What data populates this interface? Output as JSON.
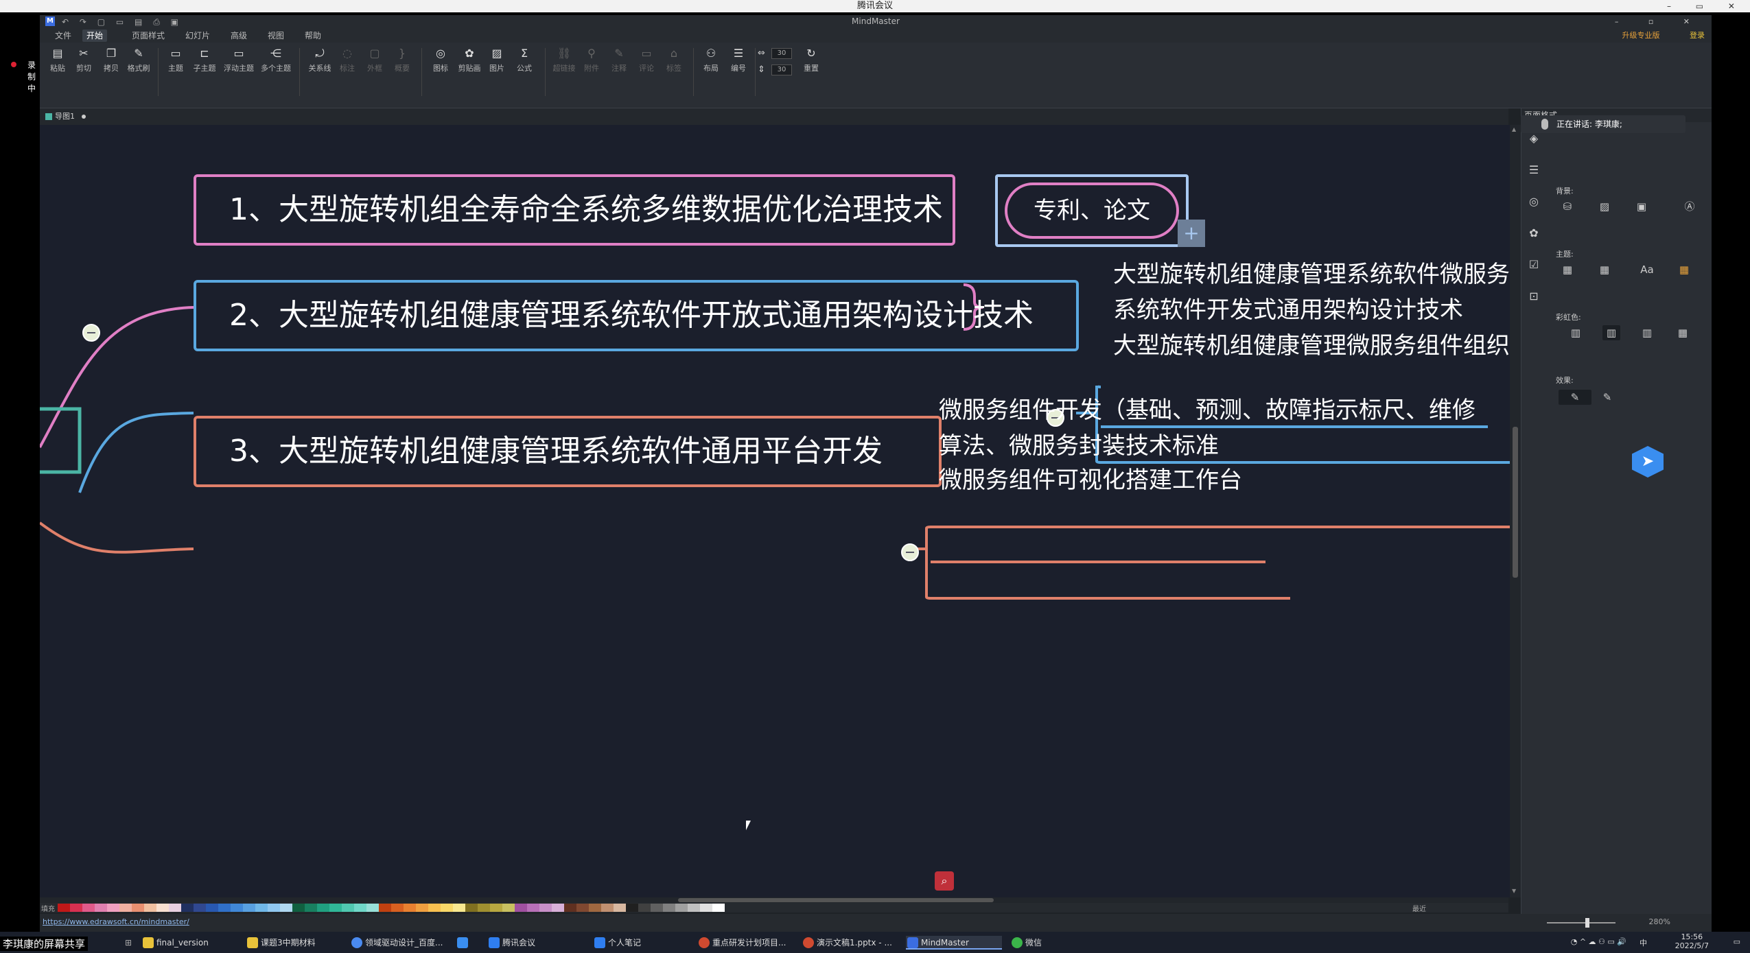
{
  "meeting": {
    "window_title": "腾讯会议",
    "recording_label": "录制中",
    "speaking_label": "正在讲话: 李琪康;",
    "share_label": "李琪康的屏幕共享"
  },
  "app": {
    "title": "MindMaster",
    "menus": [
      "文件",
      "开始",
      "页面样式",
      "幻灯片",
      "高级",
      "视图",
      "帮助"
    ],
    "active_menu": "开始",
    "upgrade_label": "升级专业版",
    "login_label": "登录"
  },
  "ribbon": {
    "groups": [
      [
        "粘贴",
        "剪切",
        "拷贝",
        "格式刷"
      ],
      [
        "主题",
        "子主题",
        "浮动主题",
        "多个主题"
      ],
      [
        "关系线",
        "标注",
        "外框",
        "概要"
      ],
      [
        "图标",
        "剪贴画",
        "图片",
        "公式"
      ],
      [
        "超链接",
        "附件",
        "注释",
        "评论",
        "标签"
      ],
      [
        "布局",
        "编号"
      ],
      [
        "重置"
      ]
    ],
    "width_value": "30",
    "height_value": "30"
  },
  "document": {
    "tab_label": "导图1"
  },
  "mindmap": {
    "branches": [
      {
        "label": "1、大型旋转机组全寿命全系统多维数据优化治理技术",
        "color": "#e07fc5",
        "summary": "专利、论文",
        "children": []
      },
      {
        "label": "2、大型旋转机组健康管理系统软件开放式通用架构设计技术",
        "color": "#5aa8e0",
        "children": [
          "大型旋转机组健康管理系统软件微服务",
          "系统软件开发式通用架构设计技术",
          "大型旋转机组健康管理微服务组件组织"
        ]
      },
      {
        "label": "3、大型旋转机组健康管理系统软件通用平台开发",
        "color": "#e0806a",
        "children": [
          "微服务组件开发（基础、预测、故障指示标尺、维修",
          "算法、微服务封装技术标准",
          "微服务组件可视化搭建工作台"
        ]
      }
    ]
  },
  "panel": {
    "title": "页面格式",
    "background_label": "背景:",
    "theme_label": "主题:",
    "rainbow_label": "彩虹色:",
    "effect_label": "效果:",
    "font_button": "Aa"
  },
  "palette": {
    "fill_label": "填充",
    "recent_label": "最近"
  },
  "status": {
    "url": "https://www.edrawsoft.cn/mindmaster/",
    "zoom": "280%"
  },
  "taskbar": {
    "items": [
      "final_version",
      "课题3中期材料",
      "领域驱动设计_百度...",
      "",
      "腾讯会议",
      "个人笔记",
      "重点研发计划项目...",
      "演示文稿1.pptx - ...",
      "MindMaster",
      "微信"
    ],
    "active_item": "MindMaster",
    "time": "15:56",
    "date": "2022/5/7",
    "ime": "中"
  },
  "colors": {
    "canvas_bg": "#1b1f2c",
    "pink": "#e07fc5",
    "blue": "#5aa8e0",
    "orange": "#e0806a"
  }
}
